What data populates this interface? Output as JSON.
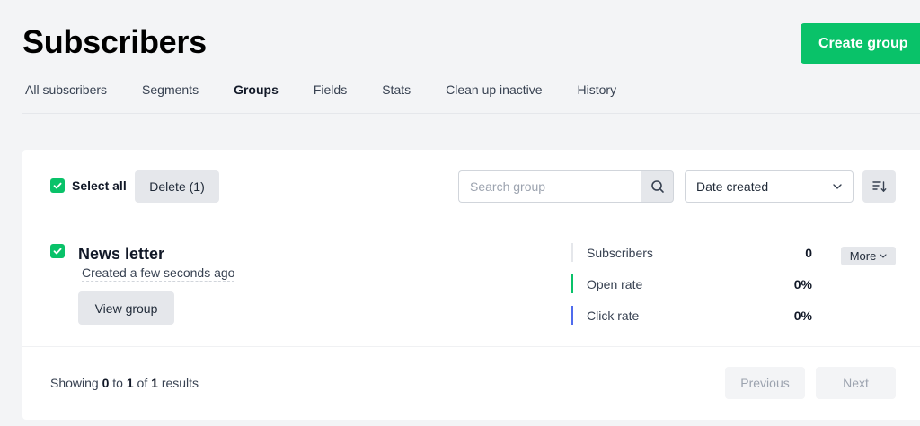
{
  "header": {
    "title": "Subscribers",
    "create_label": "Create group"
  },
  "tabs": [
    {
      "label": "All subscribers",
      "active": false
    },
    {
      "label": "Segments",
      "active": false
    },
    {
      "label": "Groups",
      "active": true
    },
    {
      "label": "Fields",
      "active": false
    },
    {
      "label": "Stats",
      "active": false
    },
    {
      "label": "Clean up inactive",
      "active": false
    },
    {
      "label": "History",
      "active": false
    }
  ],
  "toolbar": {
    "select_all_label": "Select all",
    "select_all_checked": true,
    "delete_label": "Delete (1)",
    "search_placeholder": "Search group",
    "search_value": "",
    "sort_selected": "Date created"
  },
  "group": {
    "checked": true,
    "name": "News letter",
    "created": "Created a few seconds ago",
    "view_label": "View group",
    "more_label": "More",
    "stats": [
      {
        "label": "Subscribers",
        "value": "0",
        "color": "#e5e7eb"
      },
      {
        "label": "Open rate",
        "value": "0%",
        "color": "#09c269"
      },
      {
        "label": "Click rate",
        "value": "0%",
        "color": "#4f6bed"
      }
    ]
  },
  "pagination": {
    "showing_prefix": "Showing",
    "from": "0",
    "to_word": "to",
    "to": "1",
    "of_word": "of",
    "total": "1",
    "results_word": "results",
    "previous_label": "Previous",
    "next_label": "Next"
  },
  "colors": {
    "accent": "#09c269",
    "background": "#f3f4f6"
  }
}
